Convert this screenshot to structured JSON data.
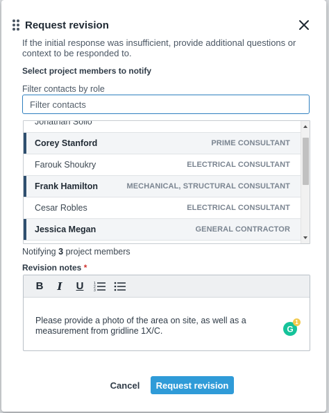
{
  "header": {
    "title": "Request revision"
  },
  "description": "If the initial response was insufficient, provide additional questions or context to be responded to.",
  "members_section": {
    "label": "Select project members to notify",
    "filter_label": "Filter contacts by role",
    "filter_placeholder": "Filter contacts",
    "partial_row_name": "Jonathan Sollo",
    "rows": [
      {
        "name": "Corey Stanford",
        "role": "PRIME CONSULTANT",
        "selected": true
      },
      {
        "name": "Farouk Shoukry",
        "role": "ELECTRICAL CONSULTANT",
        "selected": false
      },
      {
        "name": "Frank Hamilton",
        "role": "MECHANICAL, STRUCTURAL CONSULTANT",
        "selected": true
      },
      {
        "name": "Cesar Robles",
        "role": "ELECTRICAL CONSULTANT",
        "selected": false
      },
      {
        "name": "Jessica Megan",
        "role": "GENERAL CONTRACTOR",
        "selected": true
      }
    ],
    "notify_prefix": "Notifying",
    "notify_count": "3",
    "notify_suffix": "project members"
  },
  "notes": {
    "label": "Revision notes",
    "required_mark": "*",
    "toolbar": {
      "bold": "B",
      "italic": "I",
      "underline": "U"
    },
    "text": "Please provide a photo of the area on site, as well as a measurement from gridline 1X/C.",
    "grammarly_count": "1"
  },
  "footer": {
    "cancel_label": "Cancel",
    "submit_label": "Request revision"
  },
  "colors": {
    "primary": "#2f9bd8",
    "selected_bar": "#2f4f6f",
    "required": "#d0312d",
    "grammarly": "#15c39a"
  }
}
